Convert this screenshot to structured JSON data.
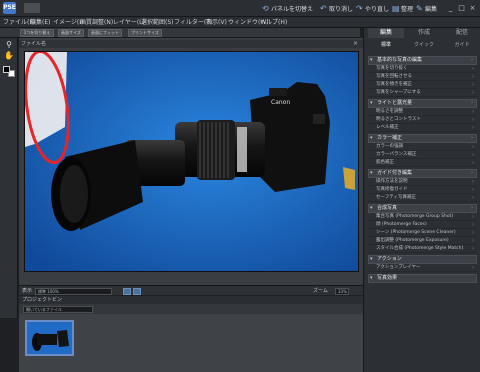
{
  "app": {
    "logo_text": "PSE",
    "colors": {
      "accent": "#3f79c8",
      "canvas_bg": "#1f6bc5",
      "annotation": "#e8242b"
    }
  },
  "titlebar": {
    "actions": [
      {
        "icon": "project-bin-icon",
        "label": "パネルを切替え"
      },
      {
        "icon": "undo-icon",
        "label": "取り消し"
      },
      {
        "icon": "redo-icon",
        "label": "やり直し"
      },
      {
        "icon": "organize-icon",
        "label": "整理"
      },
      {
        "icon": "edit-icon",
        "label": "編集"
      }
    ],
    "window_buttons": [
      "_",
      "□",
      "×"
    ]
  },
  "menubar": {
    "items": [
      "ファイル(F)",
      "編集(E)",
      "イメージ(I)",
      "画質調整(N)",
      "レイヤー(L)",
      "選択範囲(S)",
      "フィルター(T)",
      "表示(V)",
      "ウィンドウ(W)",
      "ヘルプ(H)"
    ]
  },
  "options_bar": {
    "buttons": [
      "1つを切り替え",
      "画面サイズ",
      "画面にフィット",
      "プリントサイズ"
    ]
  },
  "document": {
    "tab_title": "ファイル名",
    "close": "×"
  },
  "statusbar": {
    "label": "表示",
    "mode_value": "標準 100%",
    "zoom_label": "ズーム",
    "zoom_value": "33%"
  },
  "project_bin": {
    "label": "プロジェクトビン",
    "dropdown": "開いているファイル"
  },
  "panel": {
    "main_tabs": [
      "編集",
      "作成",
      "配信"
    ],
    "sub_tabs": [
      "標準",
      "クイック",
      "ガイド"
    ],
    "sections": [
      {
        "title": "基本的な写真の編集",
        "items": [
          "写真を切り抜く",
          "写真を回転させる",
          "写真を傾きを補正",
          "写真をシャープにする"
        ]
      },
      {
        "title": "ライトと露光量",
        "items": [
          "明るさを調整",
          "明るさとコントラスト",
          "レベル補正"
        ]
      },
      {
        "title": "カラー補正",
        "items": [
          "カラーの強調",
          "カラーバランス補正",
          "肌色補正"
        ]
      },
      {
        "title": "ガイド付き編集",
        "items": [
          "操作方法を説明",
          "写真修復ガイド",
          "セーフティ写真補正"
        ]
      },
      {
        "title": "合成写真",
        "items": [
          "集合写真 (Photomerge Group Shot)",
          "顔 (Photomerge Faces)",
          "シーン (Photomerge Scene Cleaner)",
          "露出調整 (Photomerge Exposure)",
          "スタイル合成 (Photomerge Style Match)"
        ]
      },
      {
        "title": "アクション",
        "items": [
          "アクションプレイヤー"
        ]
      },
      {
        "title": "写真効果",
        "items": []
      }
    ]
  }
}
